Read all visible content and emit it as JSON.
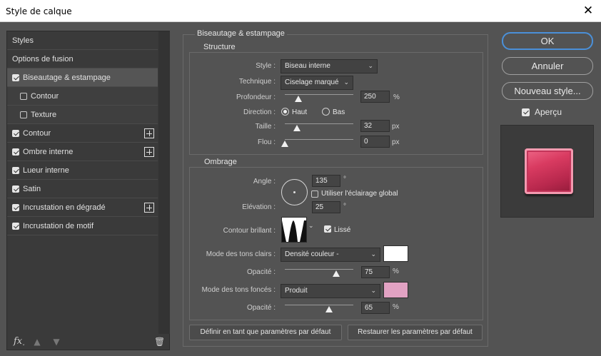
{
  "dialog": {
    "title": "Style de calque",
    "close_icon": "close-icon"
  },
  "styles_list": {
    "header": "Styles",
    "fusion": "Options de fusion",
    "items": [
      {
        "label": "Biseautage & estampage",
        "checked": true,
        "selected": true,
        "plus": false
      },
      {
        "label": "Contour",
        "checked": false,
        "sub": true,
        "plus": false
      },
      {
        "label": "Texture",
        "checked": false,
        "sub": true,
        "plus": false
      },
      {
        "label": "Contour",
        "checked": true,
        "plus": true
      },
      {
        "label": "Ombre interne",
        "checked": true,
        "plus": true
      },
      {
        "label": "Lueur interne",
        "checked": true,
        "plus": false
      },
      {
        "label": "Satin",
        "checked": true,
        "plus": false
      },
      {
        "label": "Incrustation en dégradé",
        "checked": true,
        "plus": true
      },
      {
        "label": "Incrustation de motif",
        "checked": true,
        "plus": false
      }
    ],
    "bottom_icons": {
      "fx": "fx",
      "up": "▲",
      "down": "▼",
      "trash": "🗑"
    }
  },
  "bevel": {
    "section_title": "Biseautage & estampage",
    "structure": {
      "title": "Structure",
      "style_label": "Style :",
      "style_value": "Biseau interne",
      "technique_label": "Technique :",
      "technique_value": "Ciselage marqué",
      "depth_label": "Profondeur :",
      "depth_value": "250",
      "depth_unit": "%",
      "depth_level": 0.2,
      "direction_label": "Direction :",
      "direction_up": "Haut",
      "direction_down": "Bas",
      "size_label": "Taille :",
      "size_value": "32",
      "size_unit": "px",
      "size_level": 0.18,
      "soften_label": "Flou :",
      "soften_value": "0",
      "soften_unit": "px",
      "soften_level": 0.0
    },
    "shading": {
      "title": "Ombrage",
      "angle_label": "Angle :",
      "angle_value": "135",
      "angle_unit": "°",
      "global_light_label": "Utiliser l'éclairage global",
      "altitude_label": "Elévation :",
      "altitude_value": "25",
      "altitude_unit": "°",
      "gloss_label": "Contour brillant :",
      "antialias_label": "Lissé",
      "highlight_label": "Mode des tons clairs :",
      "highlight_mode": "Densité couleur -",
      "highlight_color": "#ffffff",
      "highlight_opacity_label": "Opacité :",
      "highlight_opacity": "75",
      "highlight_opacity_unit": "%",
      "highlight_level": 0.75,
      "shadow_label": "Mode des tons foncés :",
      "shadow_mode": "Produit",
      "shadow_color": "#e2a2c3",
      "shadow_opacity_label": "Opacité :",
      "shadow_opacity": "65",
      "shadow_opacity_unit": "%",
      "shadow_level": 0.65
    },
    "default_button": "Définir en tant que paramètres par défaut",
    "reset_button": "Restaurer les paramètres par défaut"
  },
  "actions": {
    "ok": "OK",
    "cancel": "Annuler",
    "new_style": "Nouveau style...",
    "preview_label": "Aperçu",
    "preview_checked": true
  }
}
